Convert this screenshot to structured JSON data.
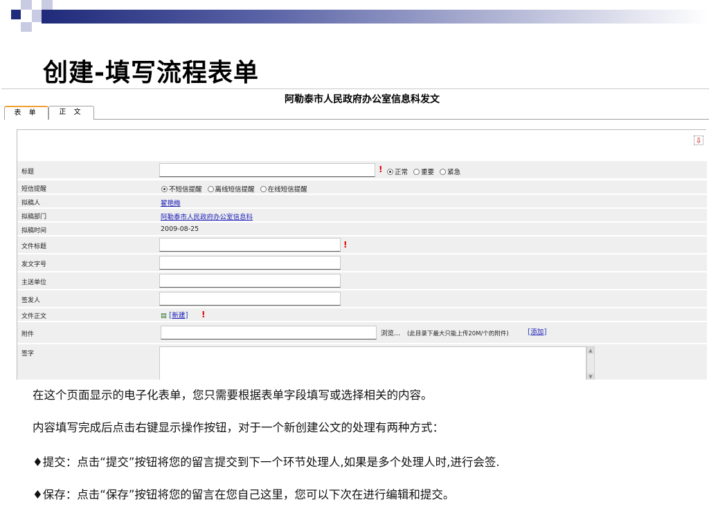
{
  "slide": {
    "title": "创建-填写流程表单"
  },
  "form_window": {
    "doc_title": "阿勒泰市人民政府办公室信息科发文",
    "tabs": [
      {
        "label": "表 单",
        "active": true
      },
      {
        "label": "正 文",
        "active": false
      }
    ],
    "fields": {
      "title": {
        "label": "标题",
        "value": "",
        "priority_options": [
          "正常",
          "重要",
          "紧急"
        ],
        "priority_selected": "正常"
      },
      "sms_alert": {
        "label": "短信提醒",
        "options": [
          "不短信提醒",
          "离线短信提醒",
          "在线短信提醒"
        ],
        "selected": "不短信提醒"
      },
      "drafter": {
        "label": "拟稿人",
        "value": "翟艳梅"
      },
      "drafting_dept": {
        "label": "拟稿部门",
        "value": "阿勒泰市人民政府办公室信息科"
      },
      "drafting_time": {
        "label": "拟稿时间",
        "value": "2009-08-25"
      },
      "doc_title_field": {
        "label": "文件标题",
        "value": ""
      },
      "doc_number": {
        "label": "发文字号",
        "value": ""
      },
      "main_recipient": {
        "label": "主送单位",
        "value": ""
      },
      "signer": {
        "label": "签发人",
        "value": ""
      },
      "doc_body": {
        "label": "文件正文",
        "new_link": "新建"
      },
      "attachment": {
        "label": "附件",
        "value": "",
        "browse_label": "浏览...",
        "hint": "(此目录下最大只能上传20M/个的附件)",
        "add_link": "添加"
      },
      "signature": {
        "label": "签字",
        "value": ""
      }
    },
    "colors": {
      "required_mark": "#e00000",
      "link": "#1a1ab8",
      "active_tab_accent": "#f0a030"
    }
  },
  "notes": [
    "在这个页面显示的电子化表单，您只需要根据表单字段填写或选择相关的内容。",
    "内容填写完成后点击右键显示操作按钮，对于一个新创建公文的处理有两种方式：",
    "♦提交：点击“提交”按钮将您的留言提交到下一个环节处理人,如果是多个处理人时,进行会签.",
    "♦保存：点击“保存”按钮将您的留言在您自己这里，您可以下次在进行编辑和提交。"
  ]
}
